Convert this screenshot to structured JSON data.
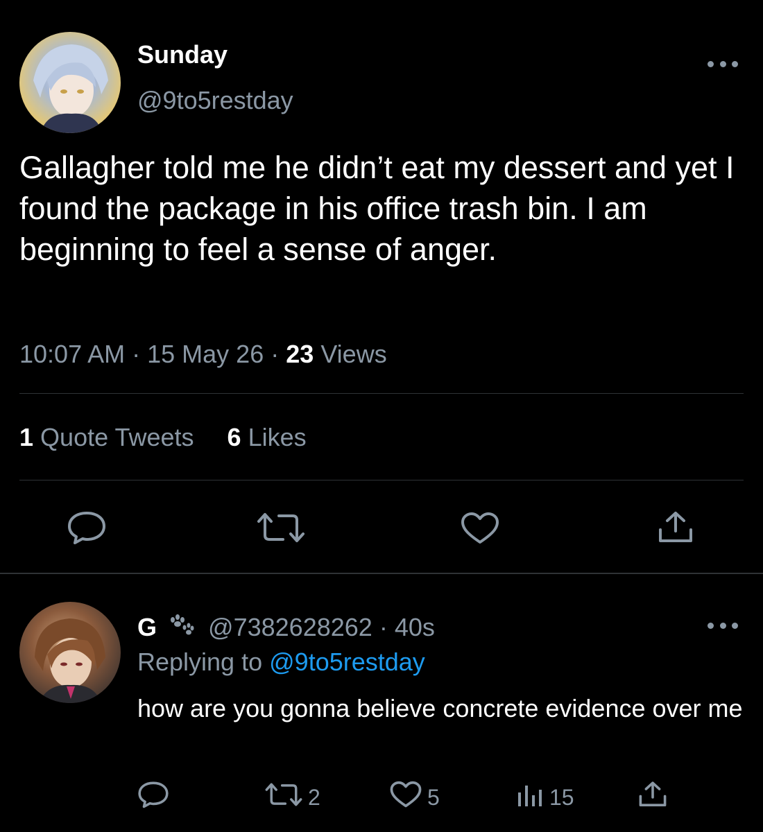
{
  "tweet": {
    "display_name": "Sunday",
    "handle": "@9to5restday",
    "text": "Gallagher told me he didn’t eat my dessert and yet I found the package in his office trash bin. I am beginning to feel a sense of anger.",
    "time": "10:07 AM",
    "date": "15 May 26",
    "views_count": "23",
    "views_label": "Views",
    "quote_count": "1",
    "quote_label": "Quote Tweets",
    "likes_count": "6",
    "likes_label": "Likes"
  },
  "reply": {
    "display_name": "G",
    "handle": "@7382628262",
    "age": "40s",
    "replying_label": "Replying to",
    "replying_handle": "@9to5restday",
    "text": "how are you gonna believe concrete evidence over me",
    "retweets": "2",
    "likes": "5",
    "views": "15"
  },
  "icons": {
    "more": "more-horizontal-icon",
    "reply": "reply-bubble-icon",
    "retweet": "retweet-icon",
    "like": "heart-icon",
    "share": "share-icon",
    "views": "views-bar-icon",
    "paw": "paw-icon"
  },
  "colors": {
    "background": "#000000",
    "text": "#ffffff",
    "muted": "#8b98a5",
    "link": "#1d9bf0",
    "divider": "#2f3336"
  }
}
